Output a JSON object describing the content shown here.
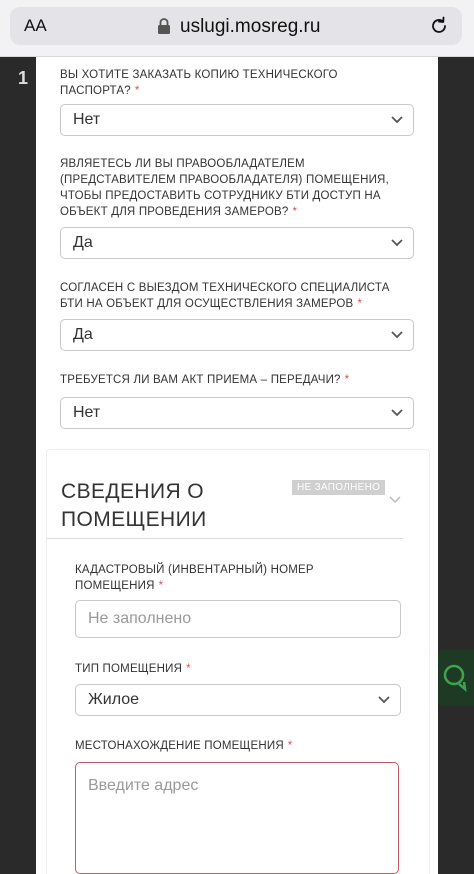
{
  "browser": {
    "aa_label": "AA",
    "url": "uslugi.mosreg.ru"
  },
  "background": {
    "digit": "1"
  },
  "questions": [
    {
      "label": "ВЫ ХОТИТЕ ЗАКАЗАТЬ КОПИЮ ТЕХНИЧЕСКОГО ПАСПОРТА?",
      "value": "Нет"
    },
    {
      "label": "ЯВЛЯЕТЕСЬ ЛИ ВЫ ПРАВООБЛАДАТЕЛЕМ (ПРЕДСТАВИТЕЛЕМ ПРАВООБЛАДАТЕЛЯ) ПОМЕЩЕНИЯ, ЧТОБЫ ПРЕДОСТАВИТЬ СОТРУДНИКУ БТИ ДОСТУП НА ОБЪЕКТ ДЛЯ ПРОВЕДЕНИЯ ЗАМЕРОВ?",
      "value": "Да"
    },
    {
      "label": "СОГЛАСЕН С ВЫЕЗДОМ ТЕХНИЧЕСКОГО СПЕЦИАЛИСТА БТИ НА ОБЪЕКТ ДЛЯ ОСУЩЕСТВЛЕНИЯ ЗАМЕРОВ",
      "value": "Да"
    },
    {
      "label": "ТРЕБУЕТСЯ ЛИ ВАМ АКТ ПРИЕМА – ПЕРЕДАЧИ?",
      "value": "Нет"
    }
  ],
  "required_mark": "*",
  "section": {
    "title": "СВЕДЕНИЯ О ПОМЕЩЕНИИ",
    "badge": "НЕ ЗАПОЛНЕНО",
    "fields": {
      "cadastral": {
        "label": "КАДАСТРОВЫЙ (ИНВЕНТАРНЫЙ) НОМЕР ПОМЕЩЕНИЯ",
        "placeholder": "Не заполнено"
      },
      "type": {
        "label": "ТИП ПОМЕЩЕНИЯ",
        "value": "Жилое"
      },
      "location": {
        "label": "МЕСТОНАХОЖДЕНИЕ ПОМЕЩЕНИЯ",
        "placeholder": "Введите адрес"
      }
    }
  },
  "colors": {
    "required": "#d9534f",
    "error_border": "#c25a6a",
    "badge_bg": "#cfcfcf"
  }
}
